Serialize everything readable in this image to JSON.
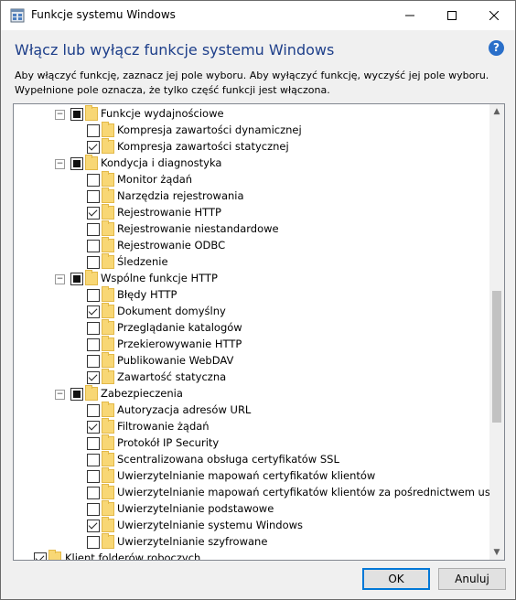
{
  "window": {
    "title": "Funkcje systemu Windows"
  },
  "heading": "Włącz lub wyłącz funkcje systemu Windows",
  "description": {
    "line1": "Aby włączyć funkcję, zaznacz jej pole wyboru. Aby wyłączyć funkcję, wyczyść jej pole wyboru.",
    "line2": "Wypełnione pole oznacza, że tylko część funkcji jest włączona."
  },
  "icons": {
    "help": "help-icon",
    "help_glyph": "?",
    "folder": "folder-icon"
  },
  "tree": [
    {
      "label": "Funkcje wydajnościowe",
      "state": "partial",
      "level": 0,
      "expander": "−"
    },
    {
      "label": "Kompresja zawartości dynamicznej",
      "state": "unchecked",
      "level": 1
    },
    {
      "label": "Kompresja zawartości statycznej",
      "state": "checked",
      "level": 1
    },
    {
      "label": "Kondycja i diagnostyka",
      "state": "partial",
      "level": 0,
      "expander": "−"
    },
    {
      "label": "Monitor żądań",
      "state": "unchecked",
      "level": 1
    },
    {
      "label": "Narzędzia rejestrowania",
      "state": "unchecked",
      "level": 1
    },
    {
      "label": "Rejestrowanie HTTP",
      "state": "checked",
      "level": 1
    },
    {
      "label": "Rejestrowanie niestandardowe",
      "state": "unchecked",
      "level": 1
    },
    {
      "label": "Rejestrowanie ODBC",
      "state": "unchecked",
      "level": 1
    },
    {
      "label": "Śledzenie",
      "state": "unchecked",
      "level": 1
    },
    {
      "label": "Wspólne funkcje HTTP",
      "state": "partial",
      "level": 0,
      "expander": "−"
    },
    {
      "label": "Błędy HTTP",
      "state": "unchecked",
      "level": 1
    },
    {
      "label": "Dokument domyślny",
      "state": "checked",
      "level": 1
    },
    {
      "label": "Przeglądanie katalogów",
      "state": "unchecked",
      "level": 1
    },
    {
      "label": "Przekierowywanie HTTP",
      "state": "unchecked",
      "level": 1
    },
    {
      "label": "Publikowanie WebDAV",
      "state": "unchecked",
      "level": 1
    },
    {
      "label": "Zawartość statyczna",
      "state": "checked",
      "level": 1
    },
    {
      "label": "Zabezpieczenia",
      "state": "partial",
      "level": 0,
      "expander": "−"
    },
    {
      "label": "Autoryzacja adresów URL",
      "state": "unchecked",
      "level": 1
    },
    {
      "label": "Filtrowanie żądań",
      "state": "checked",
      "level": 1
    },
    {
      "label": "Protokół IP Security",
      "state": "unchecked",
      "level": 1
    },
    {
      "label": "Scentralizowana obsługa certyfikatów SSL",
      "state": "unchecked",
      "level": 1
    },
    {
      "label": "Uwierzytelnianie mapowań certyfikatów klientów",
      "state": "unchecked",
      "level": 1
    },
    {
      "label": "Uwierzytelnianie mapowań certyfikatów klientów za pośrednictwem usług IIS",
      "state": "unchecked",
      "level": 1
    },
    {
      "label": "Uwierzytelnianie podstawowe",
      "state": "unchecked",
      "level": 1
    },
    {
      "label": "Uwierzytelnianie systemu Windows",
      "state": "checked",
      "level": 1
    },
    {
      "label": "Uwierzytelnianie szyfrowane",
      "state": "unchecked",
      "level": 1
    },
    {
      "label": "Klient folderów roboczych",
      "state": "checked",
      "level": -2
    }
  ],
  "buttons": {
    "ok": "OK",
    "cancel": "Anuluj"
  }
}
